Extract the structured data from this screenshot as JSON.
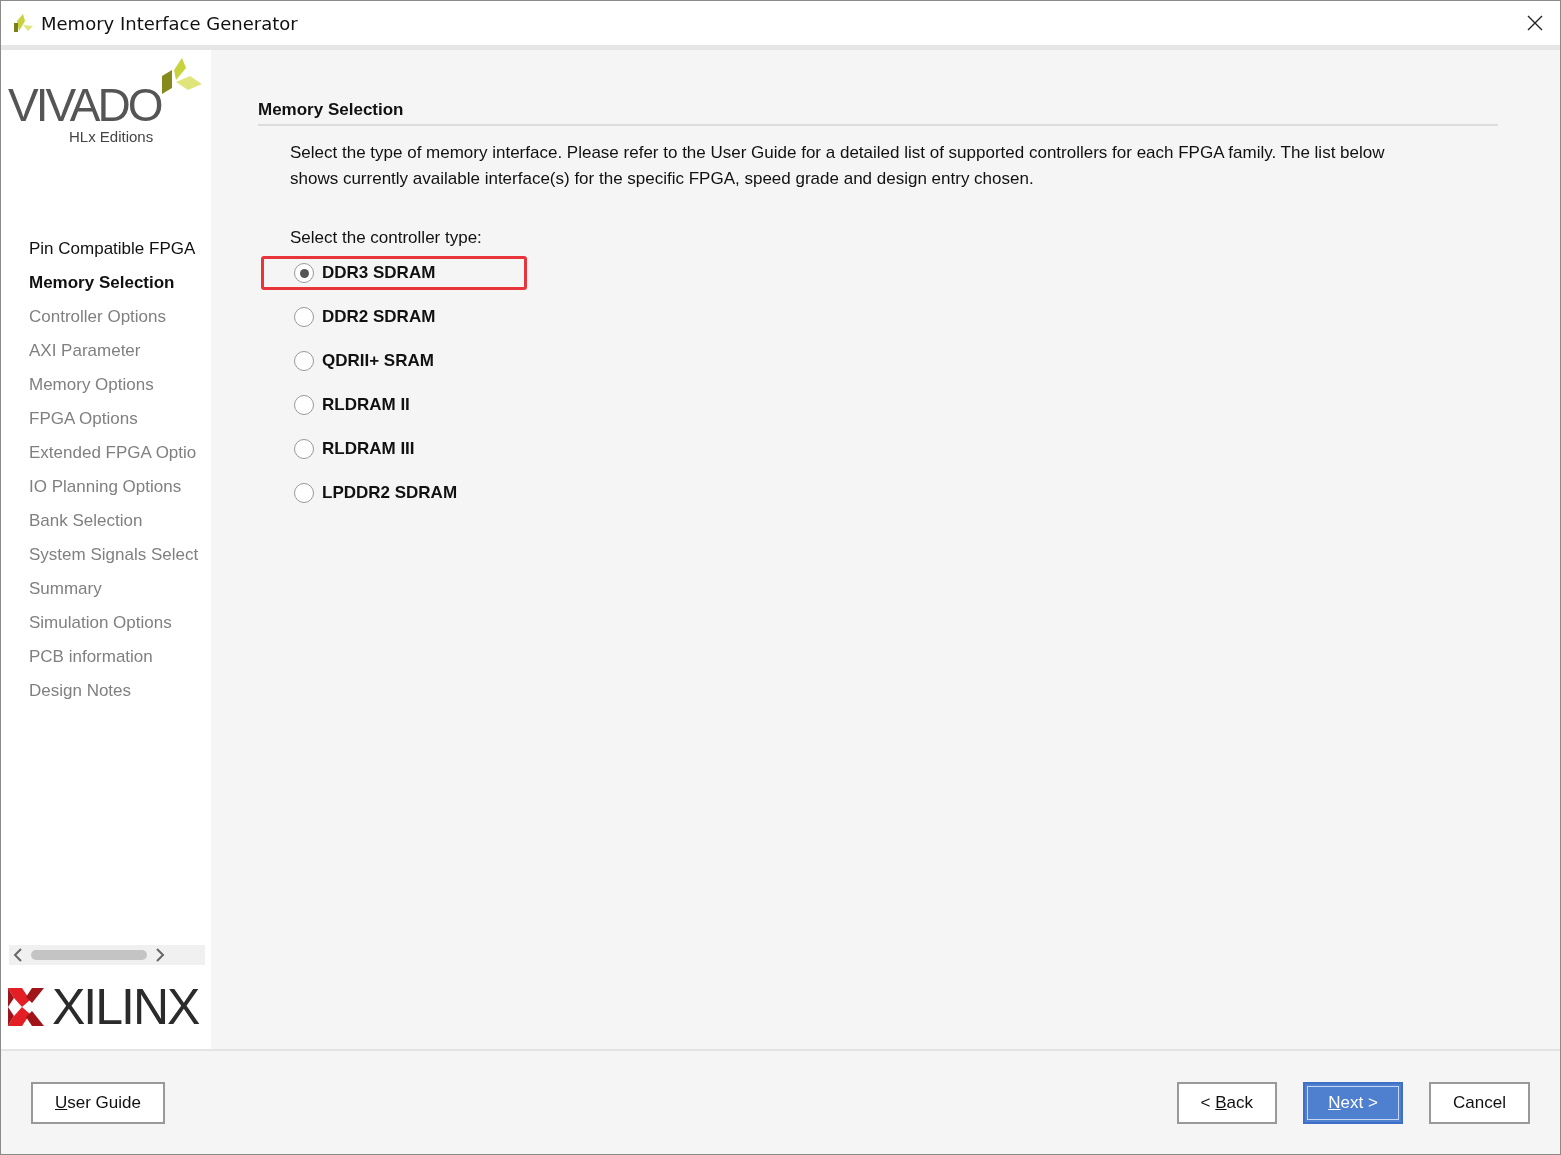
{
  "window": {
    "title": "Memory Interface Generator"
  },
  "logo": {
    "product": "VIVADO",
    "edition": "HLx Editions",
    "vendor": "XILINX"
  },
  "sidebar": {
    "items": [
      {
        "label": "Pin Compatible FPGA",
        "selected": false,
        "disabled": false
      },
      {
        "label": "Memory Selection",
        "selected": true,
        "disabled": false
      },
      {
        "label": "Controller Options",
        "selected": false,
        "disabled": true
      },
      {
        "label": "AXI Parameter",
        "selected": false,
        "disabled": true
      },
      {
        "label": "Memory Options",
        "selected": false,
        "disabled": true
      },
      {
        "label": "FPGA Options",
        "selected": false,
        "disabled": true
      },
      {
        "label": "Extended FPGA Optio",
        "selected": false,
        "disabled": true
      },
      {
        "label": "IO Planning Options",
        "selected": false,
        "disabled": true
      },
      {
        "label": "Bank Selection",
        "selected": false,
        "disabled": true
      },
      {
        "label": "System Signals Select",
        "selected": false,
        "disabled": true
      },
      {
        "label": "Summary",
        "selected": false,
        "disabled": true
      },
      {
        "label": "Simulation Options",
        "selected": false,
        "disabled": true
      },
      {
        "label": "PCB information",
        "selected": false,
        "disabled": true
      },
      {
        "label": "Design Notes",
        "selected": false,
        "disabled": true
      }
    ]
  },
  "section": {
    "title": "Memory Selection",
    "description": "Select the type of memory interface. Please refer to the User Guide for a detailed list of supported controllers for each FPGA family. The list below shows currently available interface(s) for the specific FPGA, speed grade and design entry chosen.",
    "prompt": "Select the controller type:",
    "options": [
      {
        "label": "DDR3 SDRAM",
        "selected": true,
        "highlighted": true
      },
      {
        "label": "DDR2 SDRAM",
        "selected": false,
        "highlighted": false
      },
      {
        "label": "QDRII+ SRAM",
        "selected": false,
        "highlighted": false
      },
      {
        "label": "RLDRAM II",
        "selected": false,
        "highlighted": false
      },
      {
        "label": "RLDRAM III",
        "selected": false,
        "highlighted": false
      },
      {
        "label": "LPDDR2 SDRAM",
        "selected": false,
        "highlighted": false
      }
    ]
  },
  "buttons": [
    {
      "kind": "help",
      "key": "U",
      "after": "ser Guide",
      "default": false
    },
    {
      "kind": "nav",
      "before": "< ",
      "key": "B",
      "after": "ack",
      "default": false
    },
    {
      "kind": "nav",
      "key": "N",
      "after": "ext >",
      "default": true
    },
    {
      "kind": "nav",
      "after": "Cancel",
      "default": false
    }
  ]
}
